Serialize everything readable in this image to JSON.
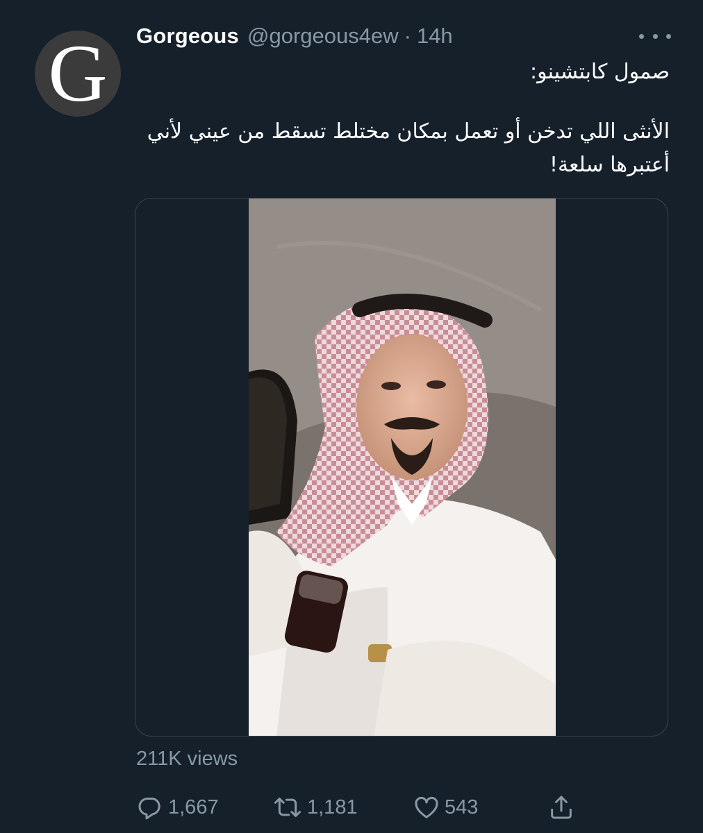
{
  "tweet": {
    "author": {
      "display_name": "Gorgeous",
      "handle": "@gorgeous4ew",
      "avatar_letter": "G"
    },
    "separator": "·",
    "timestamp": "14h",
    "text_lines": [
      "صمول كابتشينو:",
      "الأنثى اللي تدخن أو تعمل بمكان مختلط تسقط من عيني لأني أعتبرها سلعة!"
    ],
    "media": {
      "type": "video"
    },
    "views": "211K views",
    "stats": {
      "replies": "1,667",
      "retweets": "1,181",
      "likes": "543"
    }
  },
  "icons": {
    "more": "more-dots-icon",
    "reply": "reply-bubble-icon",
    "retweet": "retweet-arrows-icon",
    "like": "heart-icon",
    "share": "share-upload-icon"
  },
  "colors": {
    "background": "#15202b",
    "primary_text": "#ffffff",
    "secondary_text": "#8899a6",
    "border": "#38444d"
  }
}
